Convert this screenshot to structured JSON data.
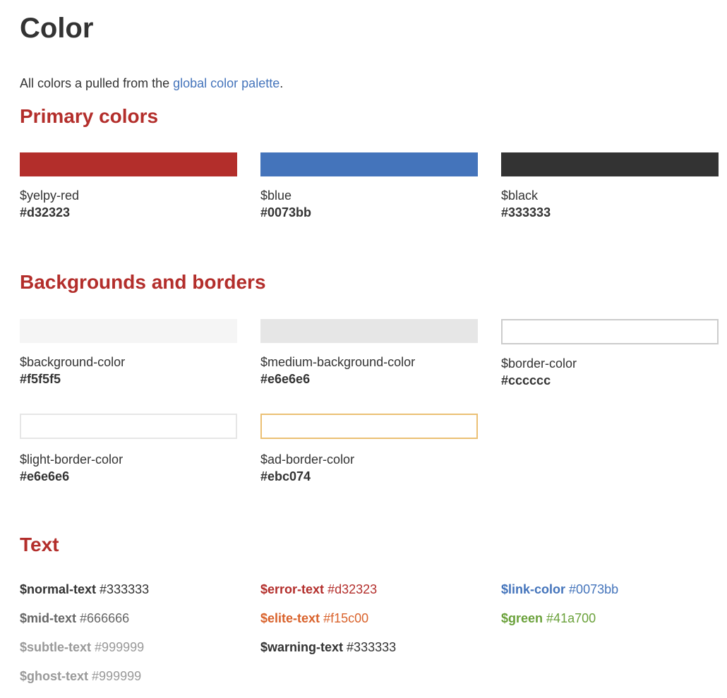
{
  "title": "Color",
  "intro": {
    "prefix": "All colors a pulled from the ",
    "link": "global color palette",
    "suffix": "."
  },
  "sections": {
    "primary": "Primary colors",
    "backgrounds": "Backgrounds and borders",
    "text": "Text"
  },
  "primary_colors": [
    {
      "name": "$yelpy-red",
      "hex": "#d32323",
      "display": "#b32e2b"
    },
    {
      "name": "$blue",
      "hex": "#0073bb",
      "display": "#4474bb"
    },
    {
      "name": "$black",
      "hex": "#333333",
      "display": "#333333"
    }
  ],
  "background_colors": [
    {
      "name": "$background-color",
      "hex": "#f5f5f5",
      "display": "#f5f5f5"
    },
    {
      "name": "$medium-background-color",
      "hex": "#e6e6e6",
      "display": "#e6e6e6"
    },
    {
      "name": "$border-color",
      "hex": "#cccccc",
      "display": "#cccccc"
    },
    {
      "name": "$light-border-color",
      "hex": "#e6e6e6",
      "display": "#e6e6e6"
    },
    {
      "name": "$ad-border-color",
      "hex": "#ebc074",
      "display": "#ebc074"
    }
  ],
  "text_colors": [
    {
      "name": "$normal-text",
      "hex": "#333333",
      "display": "#333333"
    },
    {
      "name": "$mid-text",
      "hex": "#666666",
      "display": "#666666"
    },
    {
      "name": "$subtle-text",
      "hex": "#999999",
      "display": "#999999"
    },
    {
      "name": "$ghost-text",
      "hex": "#999999",
      "display": "#999999"
    },
    {
      "name": "$error-text",
      "hex": "#d32323",
      "display": "#b32e2b"
    },
    {
      "name": "$elite-text",
      "hex": "#f15c00",
      "display": "#d9622b"
    },
    {
      "name": "$warning-text",
      "hex": "#333333",
      "display": "#333333"
    },
    {
      "name": "$link-color",
      "hex": "#0073bb",
      "display": "#4474bb"
    },
    {
      "name": "$green",
      "hex": "#41a700",
      "display": "#6aa13a"
    }
  ]
}
